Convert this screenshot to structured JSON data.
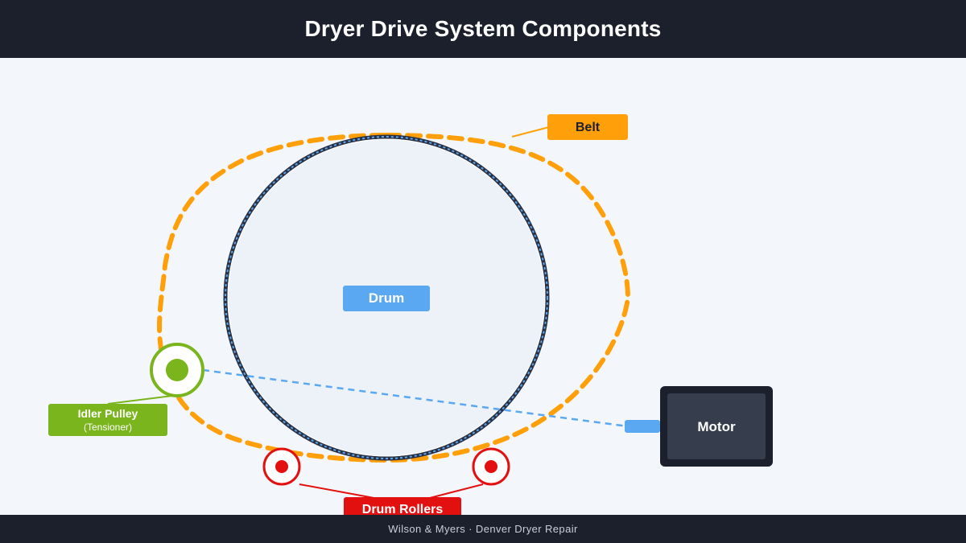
{
  "title": "Dryer Drive System Components",
  "footer": "Wilson & Myers · Denver Dryer Repair",
  "labels": {
    "belt": "Belt",
    "drum": "Drum",
    "motor": "Motor",
    "idler_pulley": "Idler Pulley",
    "idler_pulley_sub": "(Tensioner)",
    "drum_rollers": "Drum Rollers"
  },
  "colors": {
    "belt": "#ff9f0a",
    "drum": "#5aa7f2",
    "idler": "#7ab51d",
    "rollers": "#e31010",
    "motor": "#1b202c",
    "header": "#1b202c"
  }
}
